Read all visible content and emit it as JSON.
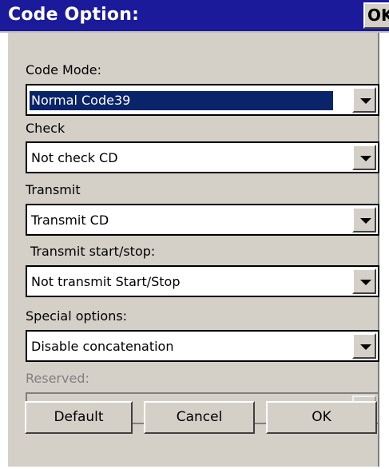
{
  "window": {
    "title": "Code Option:",
    "ok_label": "OK"
  },
  "fields": {
    "code_mode": {
      "label": "Code Mode:",
      "value": "Normal Code39"
    },
    "check": {
      "label": "Check",
      "value": "Not check CD"
    },
    "transmit": {
      "label": "Transmit",
      "value": "Transmit CD"
    },
    "transmit_start_stop": {
      "label": "Transmit start/stop:",
      "value": "Not transmit Start/Stop"
    },
    "special_options": {
      "label": "Special options:",
      "value": "Disable concatenation"
    },
    "reserved": {
      "label": "Reserved:",
      "value": ""
    }
  },
  "buttons": {
    "default": "Default",
    "cancel": "Cancel",
    "ok": "OK"
  },
  "colors": {
    "title_bar": "#1a1a9a",
    "selection": "#0a246a",
    "dialog_face": "#d4d0c8"
  },
  "icons": {
    "dropdown": "chevron-down-icon"
  }
}
